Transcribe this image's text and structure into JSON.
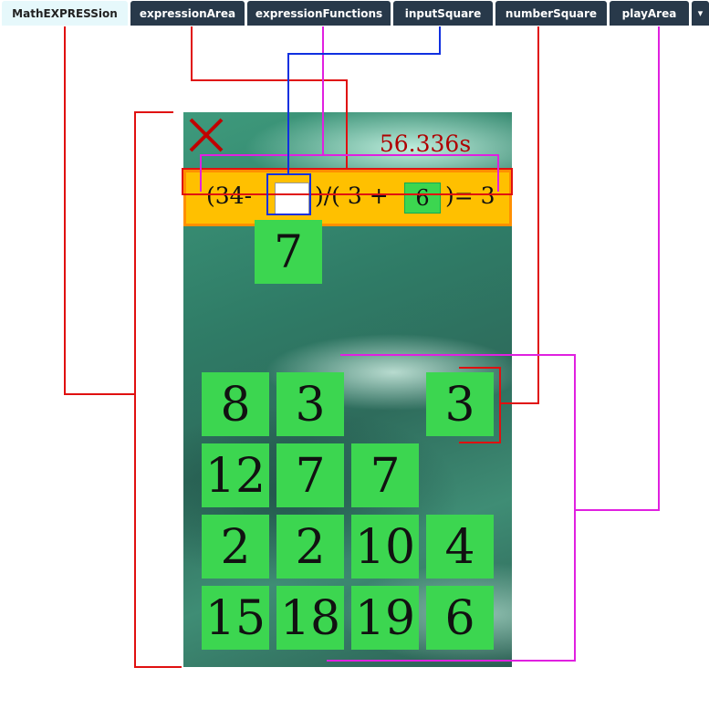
{
  "tabs": [
    {
      "label": "MathEXPRESSion",
      "active": true
    },
    {
      "label": "expressionArea",
      "active": false
    },
    {
      "label": "expressionFunctions",
      "active": false
    },
    {
      "label": "inputSquare",
      "active": false
    },
    {
      "label": "numberSquare",
      "active": false
    },
    {
      "label": "playArea",
      "active": false
    }
  ],
  "tab_more": "▾",
  "game": {
    "timer": "56.336s",
    "expression": {
      "part1": "(34-",
      "part2": ")/( 3 +",
      "number_square": "6",
      "part3": ")= 3"
    },
    "dragged_tile": "7",
    "tiles": [
      [
        "8",
        "3",
        "",
        "3"
      ],
      [
        "12",
        "7",
        "7",
        ""
      ],
      [
        "2",
        "2",
        "10",
        "4"
      ],
      [
        "15",
        "18",
        "19",
        "6"
      ]
    ]
  },
  "colors": {
    "tile": "#3cd650",
    "expression_bar": "#ffc000",
    "timer": "#b00000",
    "annotation_red": "#e01010",
    "annotation_magenta": "#e020e0",
    "annotation_blue": "#1030e0"
  }
}
